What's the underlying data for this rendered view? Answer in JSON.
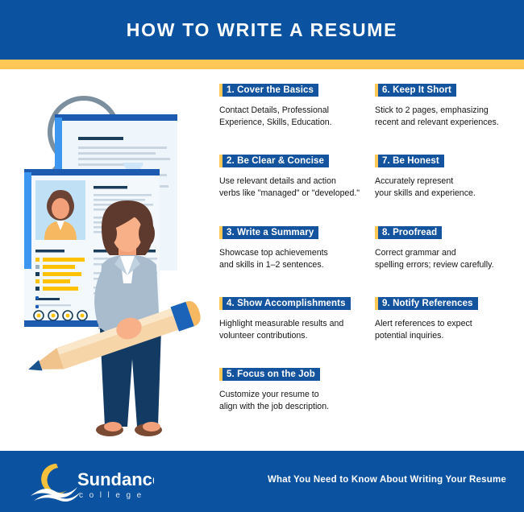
{
  "header": {
    "title": "How to Write a Resume",
    "bar_color": "#0b52a0",
    "accent_color": "#ffc857"
  },
  "illustration": {
    "name": "resume-review-illustration",
    "description": "Woman in gray blazer holding a large pencil in front of two resume documents with a magnifying glass"
  },
  "tips": {
    "left_column": [
      {
        "number": "1.",
        "title": "1.  Cover the Basics",
        "body": "Contact Details, Professional\nExperience, Skills, Education."
      },
      {
        "number": "2.",
        "title": "2. Be Clear & Concise",
        "body": "Use relevant details and action\nverbs like \"managed\" or \"developed.\""
      },
      {
        "number": "3.",
        "title": "3. Write a Summary",
        "body": "Showcase top achievements\nand skills in 1–2 sentences."
      },
      {
        "number": "4.",
        "title": "4. Show Accomplishments",
        "body": "Highlight measurable results and\nvolunteer contributions."
      },
      {
        "number": "5.",
        "title": "5. Focus on the Job",
        "body": "Customize your resume to\nalign with the job description."
      }
    ],
    "right_column": [
      {
        "number": "6.",
        "title": "6. Keep It Short",
        "body": "Stick to 2 pages, emphasizing\nrecent and relevant experiences."
      },
      {
        "number": "7.",
        "title": "7. Be Honest",
        "body": "Accurately represent\nyour skills and experience."
      },
      {
        "number": "8.",
        "title": "8. Proofread",
        "body": "Correct grammar and\nspelling errors; review carefully."
      },
      {
        "number": "9.",
        "title": "9. Notify References",
        "body": "Alert references to expect\npotential inquiries."
      }
    ]
  },
  "footer": {
    "logo_name": "Sundance",
    "logo_subtext": "c o l l e g e",
    "tagline": "What You Need to Know About Writing Your Resume",
    "background_color": "#0b52a0",
    "logo_accent_color": "#f5c13d"
  }
}
